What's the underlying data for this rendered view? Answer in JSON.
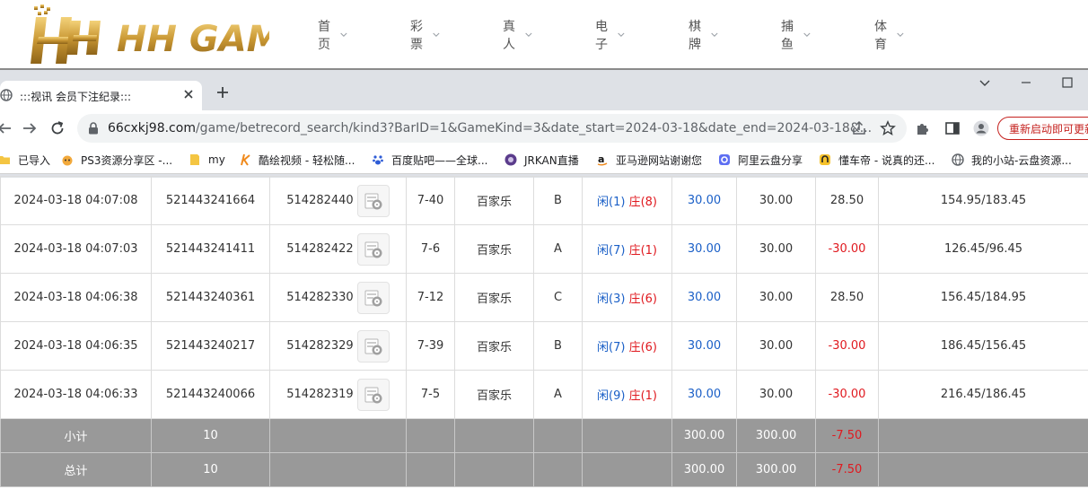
{
  "site": {
    "logo_text": "HH GAME",
    "nav": [
      "首页",
      "彩票",
      "真人",
      "电子",
      "棋牌",
      "捕鱼",
      "体育"
    ]
  },
  "browser": {
    "tab_title": ":::视讯 会员下注纪录:::",
    "url_host": "66cxkj98.com",
    "url_path": "/game/betrecord_search/kind3?BarID=1&GameKind=3&date_start=2024-03-18&date_end=2024-03-18&...",
    "restart_label": "重新启动即可更新",
    "bookmarks": [
      "已导入",
      "PS3资源分享区 -...",
      "my",
      "酷绘视频 - 轻松随...",
      "百度贴吧——全球...",
      "JRKAN直播",
      "亚马逊网站谢谢您",
      "阿里云盘分享",
      "懂车帝 - 说真的还...",
      "我的小站-云盘资源..."
    ]
  },
  "table": {
    "rows": [
      {
        "time": "2024-03-18 04:07:08",
        "bet_no": "521443241664",
        "game_no": "514282440",
        "round": "7-40",
        "game": "百家乐",
        "table": "B",
        "p": "闲(1)",
        "b": "庄(8)",
        "bet": "30.00",
        "valid": "30.00",
        "win": "28.50",
        "win_neg": false,
        "balance": "154.95/183.45"
      },
      {
        "time": "2024-03-18 04:07:03",
        "bet_no": "521443241411",
        "game_no": "514282422",
        "round": "7-6",
        "game": "百家乐",
        "table": "A",
        "p": "闲(7)",
        "b": "庄(1)",
        "bet": "30.00",
        "valid": "30.00",
        "win": "-30.00",
        "win_neg": true,
        "balance": "126.45/96.45"
      },
      {
        "time": "2024-03-18 04:06:38",
        "bet_no": "521443240361",
        "game_no": "514282330",
        "round": "7-12",
        "game": "百家乐",
        "table": "C",
        "p": "闲(3)",
        "b": "庄(6)",
        "bet": "30.00",
        "valid": "30.00",
        "win": "28.50",
        "win_neg": false,
        "balance": "156.45/184.95"
      },
      {
        "time": "2024-03-18 04:06:35",
        "bet_no": "521443240217",
        "game_no": "514282329",
        "round": "7-39",
        "game": "百家乐",
        "table": "B",
        "p": "闲(7)",
        "b": "庄(6)",
        "bet": "30.00",
        "valid": "30.00",
        "win": "-30.00",
        "win_neg": true,
        "balance": "186.45/156.45"
      },
      {
        "time": "2024-03-18 04:06:33",
        "bet_no": "521443240066",
        "game_no": "514282319",
        "round": "7-5",
        "game": "百家乐",
        "table": "A",
        "p": "闲(9)",
        "b": "庄(1)",
        "bet": "30.00",
        "valid": "30.00",
        "win": "-30.00",
        "win_neg": true,
        "balance": "216.45/186.45"
      }
    ],
    "subtotal": {
      "label": "小计",
      "count": "10",
      "bet": "300.00",
      "valid": "300.00",
      "win": "-7.50"
    },
    "total": {
      "label": "总计",
      "count": "10",
      "bet": "300.00",
      "valid": "300.00",
      "win": "-7.50"
    }
  }
}
